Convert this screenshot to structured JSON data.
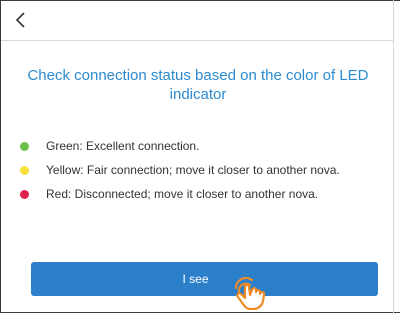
{
  "header": {
    "back_icon": "chevron-left-icon"
  },
  "main": {
    "title": "Check connection status based on the color of LED indicator",
    "legend": [
      {
        "color": "#6cc04a",
        "text": "Green: Excellent connection."
      },
      {
        "color": "#f5e13c",
        "text": "Yellow: Fair connection; move it closer to another nova."
      },
      {
        "color": "#e0234e",
        "text": "Red: Disconnected; move it closer to another nova."
      }
    ],
    "button_label": "I see",
    "pointer_icon": "tap-hand-icon"
  },
  "colors": {
    "accent": "#2c8bd0",
    "button": "#2c7fc9",
    "pointer": "#f08a24"
  }
}
